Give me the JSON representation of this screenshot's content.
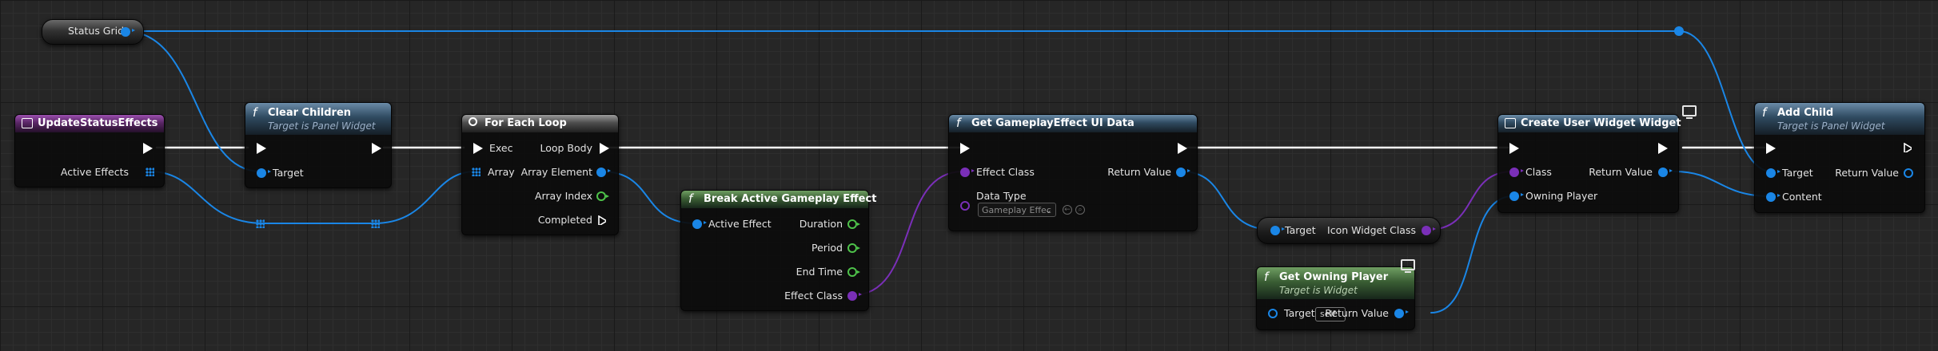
{
  "nodes": {
    "status_grid": {
      "label": "Status Grid"
    },
    "update_status_effects": {
      "title": "UpdateStatusEffects",
      "pin_active_effects": "Active Effects"
    },
    "clear_children": {
      "title": "Clear Children",
      "subtitle": "Target is Panel Widget",
      "pin_target": "Target"
    },
    "for_each_loop": {
      "title": "For Each Loop",
      "pin_exec": "Exec",
      "pin_array": "Array",
      "pin_loop_body": "Loop Body",
      "pin_array_element": "Array Element",
      "pin_array_index": "Array Index",
      "pin_completed": "Completed"
    },
    "break_active_gameplay_effect": {
      "title": "Break Active Gameplay Effect",
      "pin_active_effect": "Active Effect",
      "pin_duration": "Duration",
      "pin_period": "Period",
      "pin_end_time": "End Time",
      "pin_effect_class": "Effect Class"
    },
    "get_gameplay_effect_ui_data": {
      "title": "Get GameplayEffect UI Data",
      "pin_effect_class": "Effect Class",
      "pin_data_type": "Data Type",
      "data_type_value": "Gameplay Effec",
      "pin_return_value": "Return Value"
    },
    "icon_widget_class": {
      "pin_target": "Target",
      "pin_out": "Icon Widget Class"
    },
    "get_owning_player": {
      "title": "Get Owning Player",
      "subtitle": "Target is Widget",
      "pin_target": "Target",
      "target_value": "self",
      "pin_return_value": "Return Value"
    },
    "create_user_widget": {
      "title": "Create User Widget Widget",
      "pin_class": "Class",
      "pin_owning_player": "Owning Player",
      "pin_return_value": "Return Value"
    },
    "add_child": {
      "title": "Add Child",
      "subtitle": "Target is Panel Widget",
      "pin_target": "Target",
      "pin_content": "Content",
      "pin_return_value": "Return Value"
    }
  },
  "icons": {
    "function": "f",
    "loop": "loop-icon",
    "event": "event-icon",
    "monitor": "monitor-icon"
  },
  "colors": {
    "exec": "#ffffff",
    "object_pin": "#1a86e6",
    "class_pin": "#7a2fb8",
    "float_pin": "#4ec24a",
    "int_pin": "#4ec24a"
  }
}
